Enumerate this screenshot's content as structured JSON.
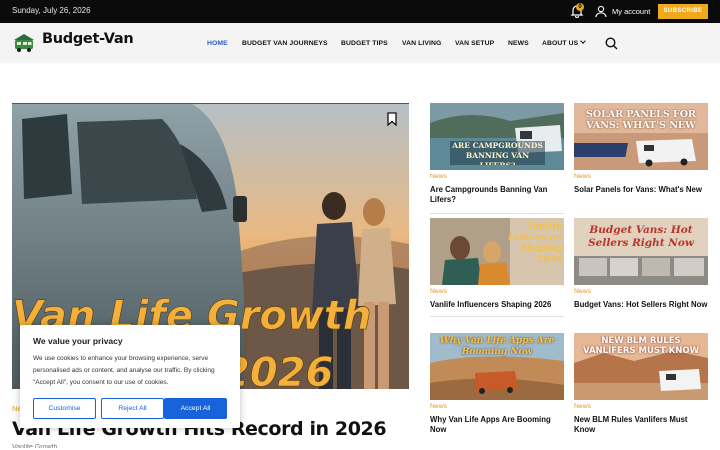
{
  "topbar": {
    "date": "Sunday, July 26, 2026",
    "notification_count": "0",
    "account_label": "My account",
    "subscribe_label": "SUBSCRIBE",
    "icons": [
      "bell-icon",
      "user-icon"
    ]
  },
  "header": {
    "logo_text": "Budget-Van",
    "nav": [
      {
        "label": "HOME",
        "active": true
      },
      {
        "label": "BUDGET VAN JOURNEYS"
      },
      {
        "label": "BUDGET TIPS"
      },
      {
        "label": "VAN LIVING"
      },
      {
        "label": "VAN SETUP"
      },
      {
        "label": "NEWS"
      },
      {
        "label": "ABOUT US"
      }
    ],
    "search_icon": "search-icon"
  },
  "hero": {
    "image_overlay_line1": "Van Life Growth",
    "image_overlay_line2": "2026",
    "category": "News",
    "title": "Van Life Growth Hits Record in 2026",
    "excerpt": "Vanlife Growth"
  },
  "cards": [
    {
      "image_text": "ARE CAMPGROUNDS BANNING VAN LIFERS?",
      "category": "News",
      "title": "Are Campgrounds Banning Van Lifers?"
    },
    {
      "image_text": "SOLAR PANELS FOR VANS: WHAT'S NEW",
      "category": "News",
      "title": "Solar Panels for Vans: What's New"
    },
    {
      "image_text": "Vanlife Influencers Shaping 2026",
      "category": "News",
      "title": "Vanlife Influencers Shaping 2026"
    },
    {
      "image_text": "Budget Vans: Hot Sellers Right Now",
      "category": "News",
      "title": "Budget Vans: Hot Sellers Right Now"
    },
    {
      "image_text": "Why Van Life Apps Are Booming Now",
      "category": "News",
      "title": "Why Van Life Apps Are Booming Now"
    },
    {
      "image_text": "NEW BLM RULES VANLIFERS MUST KNOW",
      "category": "News",
      "title": "New BLM Rules Vanlifers Must Know"
    }
  ],
  "cookie": {
    "title": "We value your privacy",
    "body": "We use cookies to enhance your browsing experience, serve personalised ads or content, and analyse our traffic. By clicking \"Accept All\", you consent to our use of cookies.",
    "customise": "Customise",
    "reject": "Reject All",
    "accept": "Accept All"
  },
  "colors": {
    "accent": "#f0a91b",
    "nav_active": "#2b59c3",
    "cookie_blue": "#1863dc",
    "category": "#e09b1a"
  }
}
